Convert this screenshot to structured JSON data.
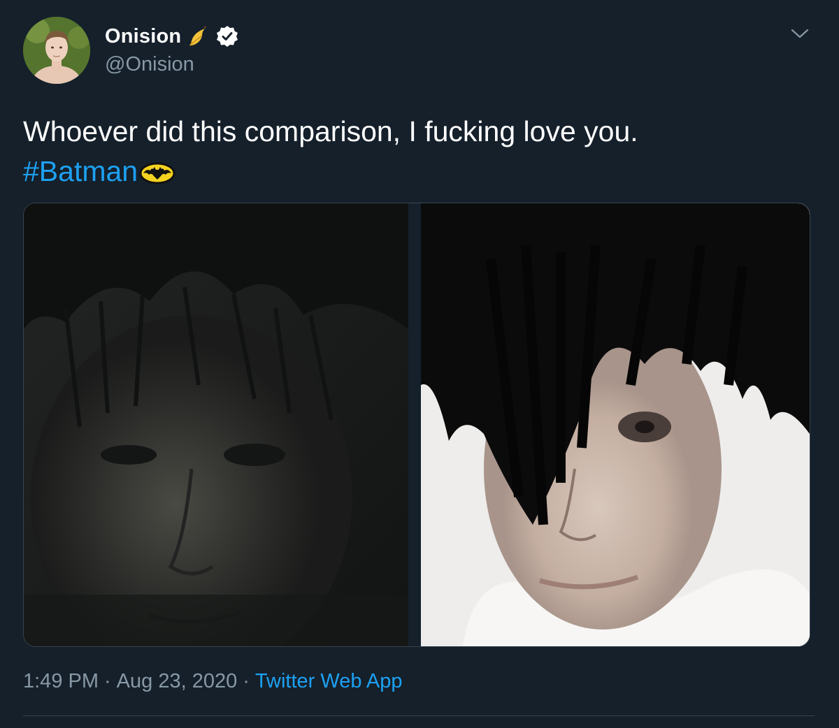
{
  "author": {
    "display_name": "Onision",
    "handle": "@Onision",
    "name_emoji": "banana-emoji",
    "verified": true
  },
  "tweet": {
    "text_line1": "Whoever did this comparison, I fucking love you.",
    "hashtag": "#Batman",
    "hashtag_emoji": "bat-emoji"
  },
  "media": {
    "images": [
      {
        "name": "media-image-left",
        "description": "dark moody close-up"
      },
      {
        "name": "media-image-right",
        "description": "bright close-up"
      }
    ]
  },
  "meta": {
    "time": "1:49 PM",
    "separator": "·",
    "date": "Aug 23, 2020",
    "source": "Twitter Web App"
  },
  "colors": {
    "background": "#15202b",
    "text": "#ffffff",
    "secondary_text": "#8899a6",
    "link": "#1da1f2",
    "border": "#38444d"
  }
}
